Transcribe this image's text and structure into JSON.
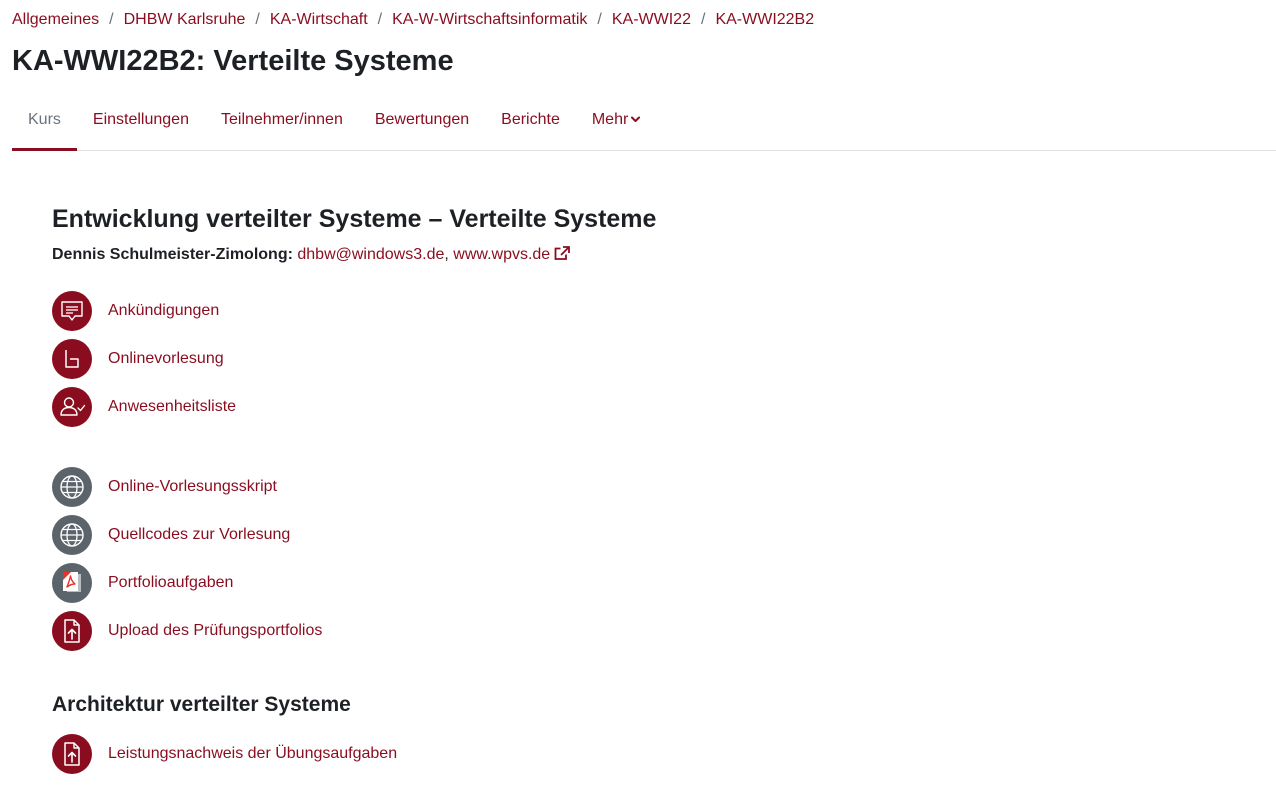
{
  "breadcrumb": [
    "Allgemeines",
    "DHBW Karlsruhe",
    "KA-Wirtschaft",
    "KA-W-Wirtschaftsinformatik",
    "KA-WWI22",
    "KA-WWI22B2"
  ],
  "breadcrumb_separator": "/",
  "page_title": "KA-WWI22B2: Verteilte Systeme",
  "nav": {
    "tabs": [
      "Kurs",
      "Einstellungen",
      "Teilnehmer/innen",
      "Bewertungen",
      "Berichte",
      "Mehr"
    ],
    "active": "Kurs",
    "more_icon": "chevron-down-icon"
  },
  "section1": {
    "title": "Entwicklung verteilter Systeme – Verteilte Systeme",
    "author_name": "Dennis Schulmeister-Zimolong:",
    "email": "dhbw@windows3.de",
    "separator": ",",
    "website": "www.wpvs.de",
    "website_icon": "external-link-icon",
    "activities": [
      {
        "label": "Ankündigungen",
        "icon": "forum-icon",
        "color": "#8a0d1f"
      },
      {
        "label": "Onlinevorlesung",
        "icon": "bigbluebutton-icon",
        "color": "#8a0d1f"
      },
      {
        "label": "Anwesenheitsliste",
        "icon": "attendance-icon",
        "color": "#8a0d1f"
      },
      {
        "label": "Online-Vorlesungsskript",
        "icon": "globe-icon",
        "color": "#5b636b"
      },
      {
        "label": "Quellcodes zur Vorlesung",
        "icon": "globe-icon",
        "color": "#5b636b"
      },
      {
        "label": "Portfolioaufgaben",
        "icon": "pdf-icon",
        "color": "#5b636b"
      },
      {
        "label": "Upload des Prüfungsportfolios",
        "icon": "upload-icon",
        "color": "#8a0d1f"
      }
    ]
  },
  "section2": {
    "title": "Architektur verteilter Systeme",
    "activities": [
      {
        "label": "Leistungsnachweis der Übungsaufgaben",
        "icon": "upload-icon",
        "color": "#8a0d1f"
      }
    ]
  },
  "colors": {
    "link": "#8a0d1f",
    "icon_red": "#8a0d1f",
    "icon_grey": "#5b636b",
    "text": "#1d2125",
    "muted": "#6a737b"
  }
}
